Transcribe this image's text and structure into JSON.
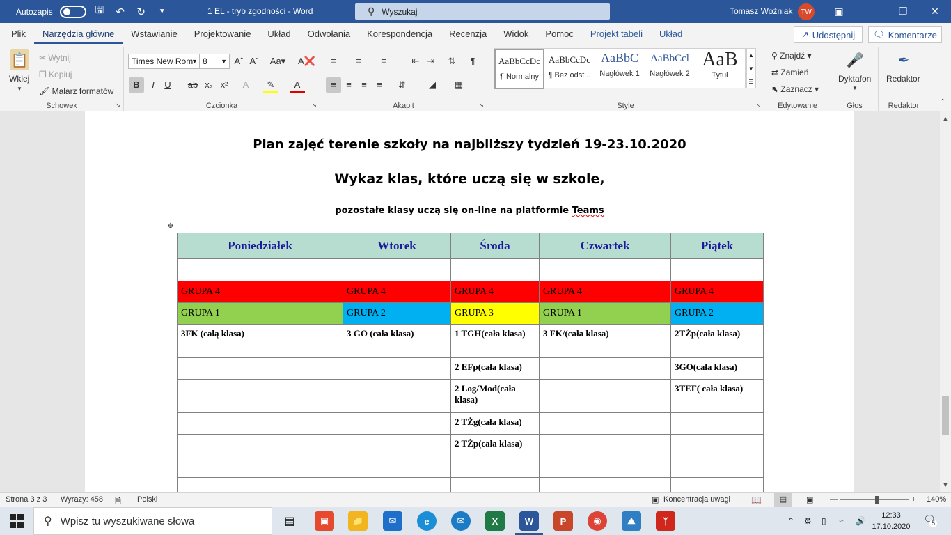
{
  "titlebar": {
    "autosave_label": "Autozapis",
    "doc_title": "1 EL  -  tryb zgodności  -  Word",
    "search_placeholder": "Wyszukaj",
    "user_name": "Tomasz Woźniak",
    "user_initials": "TW"
  },
  "tabs": [
    "Plik",
    "Narzędzia główne",
    "Wstawianie",
    "Projektowanie",
    "Układ",
    "Odwołania",
    "Korespondencja",
    "Recenzja",
    "Widok",
    "Pomoc",
    "Projekt tabeli",
    "Układ"
  ],
  "share_label": "Udostępnij",
  "comments_label": "Komentarze",
  "ribbon": {
    "clipboard": {
      "paste": "Wklej",
      "cut": "Wytnij",
      "copy": "Kopiuj",
      "format_painter": "Malarz formatów",
      "label": "Schowek"
    },
    "font": {
      "name": "Times New Rom",
      "size": "8",
      "label": "Czcionka"
    },
    "paragraph": {
      "label": "Akapit"
    },
    "styles": {
      "label": "Style",
      "items": [
        {
          "sample": "AaBbCcDc",
          "name": "¶ Normalny"
        },
        {
          "sample": "AaBbCcDc",
          "name": "¶ Bez odst..."
        },
        {
          "sample": "AaBbC",
          "name": "Nagłówek 1"
        },
        {
          "sample": "AaBbCcl",
          "name": "Nagłówek 2"
        },
        {
          "sample": "AaB",
          "name": "Tytuł"
        }
      ]
    },
    "editing": {
      "find": "Znajdź",
      "replace": "Zamień",
      "select": "Zaznacz",
      "label": "Edytowanie"
    },
    "voice": {
      "dictate": "Dyktafon",
      "label": "Głos"
    },
    "editor": {
      "button": "Redaktor",
      "label": "Redaktor"
    }
  },
  "document": {
    "heading1": "Plan zajęć terenie szkoły na najbliższy tydzień 19-23.10.2020",
    "heading2": "Wykaz klas, które uczą się w szkole,",
    "subheading_prefix": "pozostałe klasy uczą się on-line na platformie ",
    "subheading_word": "Teams",
    "table": {
      "headers": [
        "Poniedziałek",
        "Wtorek",
        "Środa",
        "Czwartek",
        "Piątek"
      ],
      "group_row_1": [
        "GRUPA 4",
        "GRUPA 4",
        "GRUPA 4",
        "GRUPA 4",
        "GRUPA 4"
      ],
      "group_row_2": [
        "GRUPA 1",
        "GRUPA 2",
        "GRUPA 3",
        "GRUPA 1",
        "GRUPA 2"
      ],
      "class_rows": [
        [
          "3FK (całą klasa)",
          "3 GO (cała klasa)",
          "1 TGH(cała klasa)",
          "3 FK/(cała klasa)",
          "2TŻp(cała klasa)"
        ],
        [
          "",
          "",
          "2 EFp(cała klasa)",
          "",
          "3GO(cała klasa)"
        ],
        [
          "",
          "",
          "2 Log/Mod(cała klasa)",
          "",
          "3TEF( cała klasa)"
        ],
        [
          "",
          "",
          "2 TŻg(cała klasa)",
          "",
          ""
        ],
        [
          "",
          "",
          "2 TŻp(cała klasa)",
          "",
          ""
        ]
      ]
    },
    "colors": {
      "red": "#ff0000",
      "green": "#92d050",
      "blue": "#00b0f0",
      "yellow": "#ffff00",
      "header": "#b7ddd0"
    }
  },
  "statusbar": {
    "page": "Strona 3 z 3",
    "words": "Wyrazy: 458",
    "language": "Polski",
    "focus": "Koncentracja uwagi",
    "zoom": "140%"
  },
  "taskbar": {
    "search_placeholder": "Wpisz tu wyszukiwane słowa",
    "time": "12:33",
    "date": "17.10.2020",
    "notifications": "5"
  }
}
